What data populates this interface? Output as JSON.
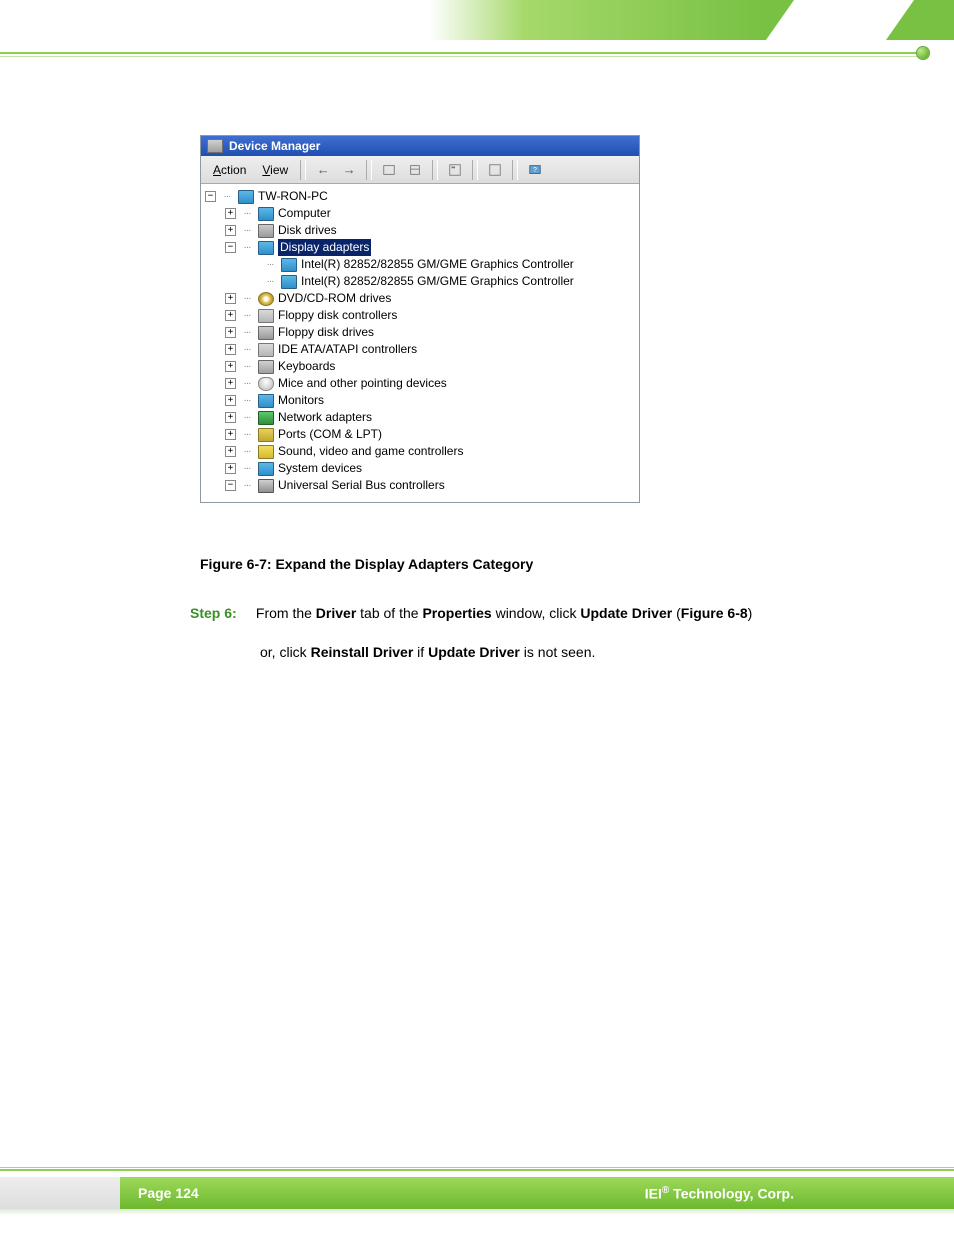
{
  "header": {},
  "screenshot": {
    "title": "Device Manager",
    "menu": {
      "action": "Action",
      "view": "View"
    },
    "tree": {
      "root": "TW-RON-PC",
      "nodes": [
        {
          "label": "Computer",
          "icon": "monitor",
          "exp": "+"
        },
        {
          "label": "Disk drives",
          "icon": "disk",
          "exp": "+"
        },
        {
          "label": "Display adapters",
          "icon": "monitor",
          "exp": "−",
          "selected": true,
          "children": [
            "Intel(R) 82852/82855 GM/GME Graphics Controller",
            "Intel(R) 82852/82855 GM/GME Graphics Controller"
          ]
        },
        {
          "label": "DVD/CD-ROM drives",
          "icon": "cd",
          "exp": "+"
        },
        {
          "label": "Floppy disk controllers",
          "icon": "ctrl",
          "exp": "+"
        },
        {
          "label": "Floppy disk drives",
          "icon": "disk",
          "exp": "+"
        },
        {
          "label": "IDE ATA/ATAPI controllers",
          "icon": "ctrl",
          "exp": "+"
        },
        {
          "label": "Keyboards",
          "icon": "kbd",
          "exp": "+"
        },
        {
          "label": "Mice and other pointing devices",
          "icon": "mouse",
          "exp": "+"
        },
        {
          "label": "Monitors",
          "icon": "monitor",
          "exp": "+"
        },
        {
          "label": "Network adapters",
          "icon": "net",
          "exp": "+"
        },
        {
          "label": "Ports (COM & LPT)",
          "icon": "port",
          "exp": "+"
        },
        {
          "label": "Sound, video and game controllers",
          "icon": "sound",
          "exp": "+"
        },
        {
          "label": "System devices",
          "icon": "monitor",
          "exp": "+"
        },
        {
          "label": "Universal Serial Bus controllers",
          "icon": "usb",
          "exp": "−"
        }
      ]
    }
  },
  "caption": "Figure 6-7: Expand the Display Adapters Category",
  "body": {
    "step_label": "Step 6:",
    "parts": {
      "p1": "From the ",
      "b1": "Driver",
      "p2": " tab of the ",
      "b2": "Properties",
      "p3": " window, click ",
      "b3": "Update Driver",
      "p4": " (",
      "b4": "Figure 6-8",
      "p5": ")",
      "p6": "or, click ",
      "b5": "Reinstall Driver",
      "p7": " if ",
      "b6": "Update Driver",
      "p8": " is not seen."
    }
  },
  "footer": {
    "page": "Page 124",
    "corp_prefix": "IEI",
    "corp_reg": "®",
    "corp_suffix": " Technology, Corp."
  }
}
